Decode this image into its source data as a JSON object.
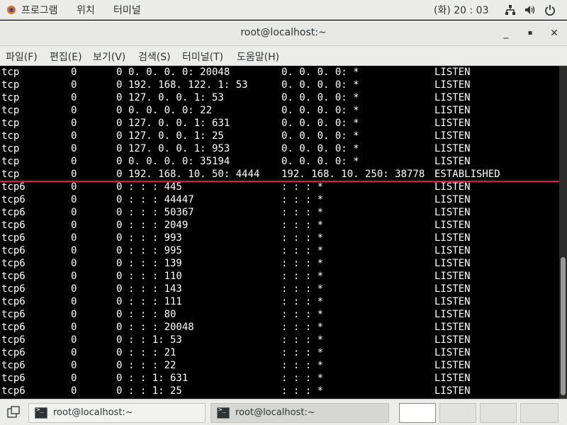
{
  "topbar": {
    "menus": [
      "프로그램",
      "위치",
      "터미널"
    ],
    "clock": "(화) 20 : 03"
  },
  "window": {
    "title": "root@localhost:~",
    "buttons": {
      "minimize": "_",
      "maximize": "▪",
      "close": "✕"
    }
  },
  "menubar": {
    "items": [
      "파일(F)",
      "편집(E)",
      "보기(V)",
      "검색(S)",
      "터미널(T)",
      "도움말(H)"
    ]
  },
  "terminal": {
    "rows": [
      {
        "proto": "tcp",
        "recvq": "0",
        "sendq": "0",
        "local": "0. 0. 0. 0: 20048",
        "foreign": "0. 0. 0. 0: *",
        "state": "LISTEN"
      },
      {
        "proto": "tcp",
        "recvq": "0",
        "sendq": "0",
        "local": "192. 168. 122. 1: 53",
        "foreign": "0. 0. 0. 0: *",
        "state": "LISTEN"
      },
      {
        "proto": "tcp",
        "recvq": "0",
        "sendq": "0",
        "local": "127. 0. 0. 1: 53",
        "foreign": "0. 0. 0. 0: *",
        "state": "LISTEN"
      },
      {
        "proto": "tcp",
        "recvq": "0",
        "sendq": "0",
        "local": "0. 0. 0. 0: 22",
        "foreign": "0. 0. 0. 0: *",
        "state": "LISTEN"
      },
      {
        "proto": "tcp",
        "recvq": "0",
        "sendq": "0",
        "local": "127. 0. 0. 1: 631",
        "foreign": "0. 0. 0. 0: *",
        "state": "LISTEN"
      },
      {
        "proto": "tcp",
        "recvq": "0",
        "sendq": "0",
        "local": "127. 0. 0. 1: 25",
        "foreign": "0. 0. 0. 0: *",
        "state": "LISTEN"
      },
      {
        "proto": "tcp",
        "recvq": "0",
        "sendq": "0",
        "local": "127. 0. 0. 1: 953",
        "foreign": "0. 0. 0. 0: *",
        "state": "LISTEN"
      },
      {
        "proto": "tcp",
        "recvq": "0",
        "sendq": "0",
        "local": "0. 0. 0. 0: 35194",
        "foreign": "0. 0. 0. 0: *",
        "state": "LISTEN"
      },
      {
        "proto": "tcp",
        "recvq": "0",
        "sendq": "0",
        "local": "192. 168. 10. 50: 4444",
        "foreign": "192. 168. 10. 250: 38778",
        "state": "ESTABLISHED"
      },
      {
        "proto": "tcp6",
        "recvq": "0",
        "sendq": "0",
        "local": ": : : 445",
        "foreign": ": : : *",
        "state": "LISTEN"
      },
      {
        "proto": "tcp6",
        "recvq": "0",
        "sendq": "0",
        "local": ": : : 44447",
        "foreign": ": : : *",
        "state": "LISTEN"
      },
      {
        "proto": "tcp6",
        "recvq": "0",
        "sendq": "0",
        "local": ": : : 50367",
        "foreign": ": : : *",
        "state": "LISTEN"
      },
      {
        "proto": "tcp6",
        "recvq": "0",
        "sendq": "0",
        "local": ": : : 2049",
        "foreign": ": : : *",
        "state": "LISTEN"
      },
      {
        "proto": "tcp6",
        "recvq": "0",
        "sendq": "0",
        "local": ": : : 993",
        "foreign": ": : : *",
        "state": "LISTEN"
      },
      {
        "proto": "tcp6",
        "recvq": "0",
        "sendq": "0",
        "local": ": : : 995",
        "foreign": ": : : *",
        "state": "LISTEN"
      },
      {
        "proto": "tcp6",
        "recvq": "0",
        "sendq": "0",
        "local": ": : : 139",
        "foreign": ": : : *",
        "state": "LISTEN"
      },
      {
        "proto": "tcp6",
        "recvq": "0",
        "sendq": "0",
        "local": ": : : 110",
        "foreign": ": : : *",
        "state": "LISTEN"
      },
      {
        "proto": "tcp6",
        "recvq": "0",
        "sendq": "0",
        "local": ": : : 143",
        "foreign": ": : : *",
        "state": "LISTEN"
      },
      {
        "proto": "tcp6",
        "recvq": "0",
        "sendq": "0",
        "local": ": : : 111",
        "foreign": ": : : *",
        "state": "LISTEN"
      },
      {
        "proto": "tcp6",
        "recvq": "0",
        "sendq": "0",
        "local": ": : : 80",
        "foreign": ": : : *",
        "state": "LISTEN"
      },
      {
        "proto": "tcp6",
        "recvq": "0",
        "sendq": "0",
        "local": ": : : 20048",
        "foreign": ": : : *",
        "state": "LISTEN"
      },
      {
        "proto": "tcp6",
        "recvq": "0",
        "sendq": "0",
        "local": ": : 1: 53",
        "foreign": ": : : *",
        "state": "LISTEN"
      },
      {
        "proto": "tcp6",
        "recvq": "0",
        "sendq": "0",
        "local": ": : : 21",
        "foreign": ": : : *",
        "state": "LISTEN"
      },
      {
        "proto": "tcp6",
        "recvq": "0",
        "sendq": "0",
        "local": ": : : 22",
        "foreign": ": : : *",
        "state": "LISTEN"
      },
      {
        "proto": "tcp6",
        "recvq": "0",
        "sendq": "0",
        "local": ": : 1: 631",
        "foreign": ": : : *",
        "state": "LISTEN"
      },
      {
        "proto": "tcp6",
        "recvq": "0",
        "sendq": "0",
        "local": ": : 1: 25",
        "foreign": ": : : *",
        "state": "LISTEN"
      }
    ],
    "highlight_color": "#e3173a"
  },
  "taskbar": {
    "tasks": [
      {
        "label": "root@localhost:~",
        "icon": "terminal-icon"
      },
      {
        "label": "root@localhost:~",
        "icon": "terminal-icon"
      }
    ],
    "show_desktop_icon": "show-desktop-icon"
  }
}
